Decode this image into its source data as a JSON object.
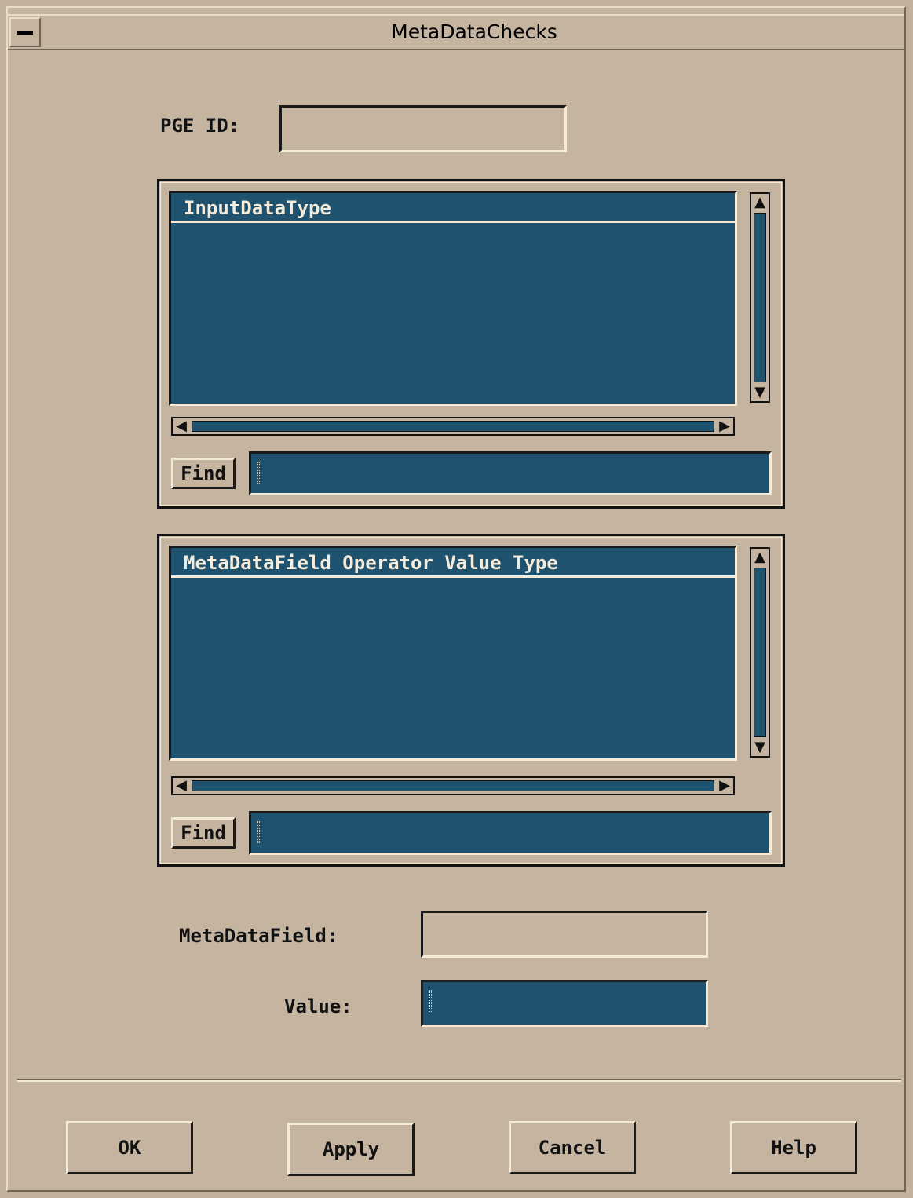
{
  "window": {
    "title": "MetaDataChecks"
  },
  "form": {
    "pge_id_label": "PGE ID:",
    "pge_id_value": "",
    "metadatafield_label": "MetaDataField:",
    "metadatafield_value": "",
    "value_label": "Value:",
    "value_value": ""
  },
  "input_data_list": {
    "header": "InputDataType",
    "items": [],
    "find_label": "Find",
    "find_value": ""
  },
  "metadata_list": {
    "header": "MetaDataField Operator Value Type",
    "items": [],
    "find_label": "Find",
    "find_value": ""
  },
  "buttons": {
    "ok": "OK",
    "apply": "Apply",
    "cancel": "Cancel",
    "help": "Help"
  },
  "colors": {
    "background": "#c4b4a0",
    "list_background": "#1e526e",
    "list_text": "#f4ecdc"
  }
}
